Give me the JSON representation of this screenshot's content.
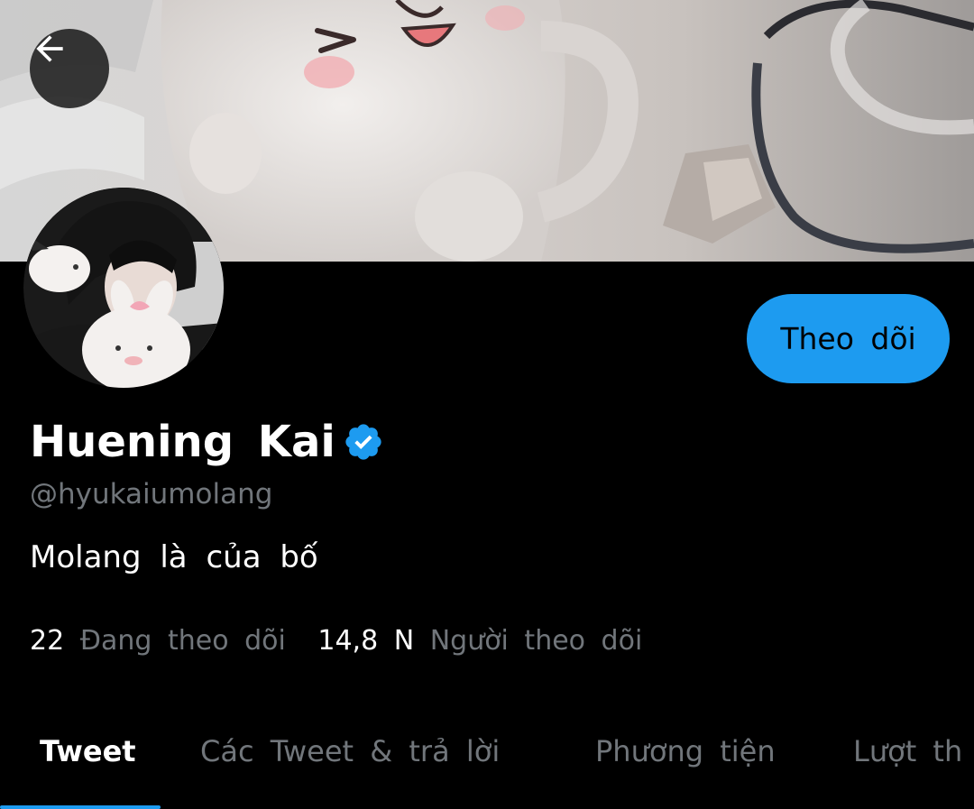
{
  "header": {
    "back_icon": "arrow-left-icon",
    "banner_description_colors": {
      "background": "#cfcac7"
    }
  },
  "profile": {
    "display_name": "Huening Kai",
    "verified_icon": "verified-badge-icon",
    "handle": "@hyukaiumolang",
    "bio": "Molang là của bố",
    "follow_label": "Theo dõi"
  },
  "stats": {
    "following_count": "22",
    "following_label": "Đang theo dõi",
    "followers_count": "14,8 N",
    "followers_label": "Người theo dõi"
  },
  "tabs": [
    {
      "label": "Tweet",
      "active": true
    },
    {
      "label": "Các Tweet & trả lời",
      "active": false
    },
    {
      "label": "Phương tiện",
      "active": false
    },
    {
      "label": "Lượt th",
      "active": false
    }
  ],
  "colors": {
    "accent": "#1d9bf0",
    "background": "#000000",
    "text_primary": "#ffffff",
    "text_secondary": "#71767b"
  }
}
